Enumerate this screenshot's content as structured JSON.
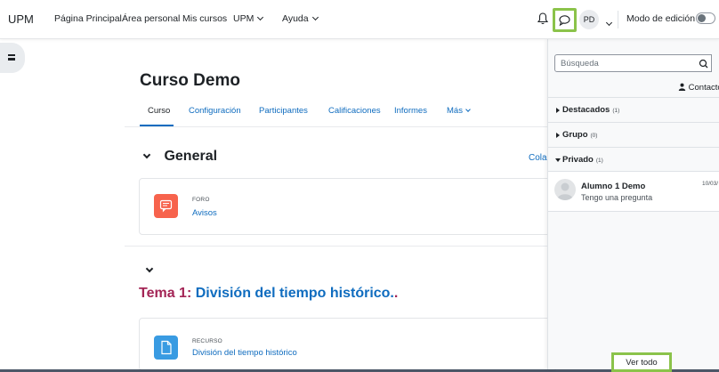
{
  "topbar": {
    "brand": "UPM",
    "nav": [
      {
        "label": "Página Principal"
      },
      {
        "label": "Área personal"
      },
      {
        "label": "Mis cursos"
      },
      {
        "label": "UPM"
      },
      {
        "label": "Ayuda"
      }
    ],
    "user_initials": "PD",
    "edit_mode_label": "Modo de edición",
    "edit_mode_on": false
  },
  "course": {
    "title": "Curso Demo",
    "tabs": [
      {
        "label": "Curso",
        "active": true
      },
      {
        "label": "Configuración",
        "active": false
      },
      {
        "label": "Participantes",
        "active": false
      },
      {
        "label": "Calificaciones",
        "active": false
      },
      {
        "label": "Informes",
        "active": false
      },
      {
        "label": "Más",
        "active": false
      }
    ],
    "collapse_label": "Colap",
    "sections": [
      {
        "title": "General",
        "activities": [
          {
            "type": "FORO",
            "name": "Avisos",
            "color": "#f7634d"
          }
        ]
      },
      {
        "title_prefix": "Tema 1:",
        "title_link": "División del tiempo histórico.",
        "prefix_color": "#a32455",
        "link_color": "#0f6cbf",
        "activities": [
          {
            "type": "RECURSO",
            "name": "División del tiempo histórico",
            "color": "#399be2"
          }
        ]
      }
    ]
  },
  "messages": {
    "search_placeholder": "Búsqueda",
    "contacts_label": "Contacto",
    "groups": [
      {
        "label": "Destacados",
        "count": "(1)",
        "expanded": false
      },
      {
        "label": "Grupo",
        "count": "(0)",
        "expanded": false
      },
      {
        "label": "Privado",
        "count": "(1)",
        "expanded": true
      }
    ],
    "conversations": [
      {
        "name": "Alumno 1 Demo",
        "preview": "Tengo una pregunta",
        "date": "10/03/"
      }
    ],
    "view_all_label": "Ver todo"
  },
  "colors": {
    "link": "#0f6cbf",
    "highlight": "#8bc34a"
  }
}
